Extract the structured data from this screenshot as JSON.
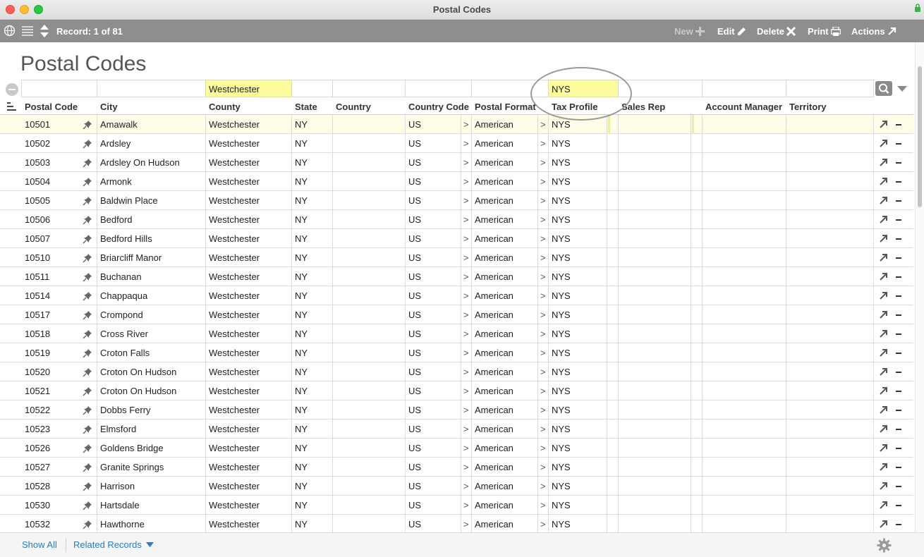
{
  "window": {
    "title": "Postal Codes"
  },
  "toolbar": {
    "record_label": "Record: 1 of 81",
    "new_label": "New",
    "edit_label": "Edit",
    "delete_label": "Delete",
    "print_label": "Print",
    "actions_label": "Actions"
  },
  "layout": {
    "title": "Postal Codes"
  },
  "find": {
    "county": "Westchester",
    "tax_profile": "NYS"
  },
  "columns": [
    "Postal Code",
    "City",
    "County",
    "State",
    "Country",
    "Country Code",
    "Postal Format",
    "Tax Profile",
    "Sales Rep",
    "Account Manager",
    "Territory"
  ],
  "rows": [
    {
      "postal_code": "10501",
      "city": "Amawalk",
      "county": "Westchester",
      "state": "NY",
      "country": "",
      "country_code": "US",
      "postal_format": "American",
      "tax_profile": "NYS",
      "sales_rep": "",
      "account_manager": "",
      "territory": ""
    },
    {
      "postal_code": "10502",
      "city": "Ardsley",
      "county": "Westchester",
      "state": "NY",
      "country": "",
      "country_code": "US",
      "postal_format": "American",
      "tax_profile": "NYS",
      "sales_rep": "",
      "account_manager": "",
      "territory": ""
    },
    {
      "postal_code": "10503",
      "city": "Ardsley On Hudson",
      "county": "Westchester",
      "state": "NY",
      "country": "",
      "country_code": "US",
      "postal_format": "American",
      "tax_profile": "NYS",
      "sales_rep": "",
      "account_manager": "",
      "territory": ""
    },
    {
      "postal_code": "10504",
      "city": "Armonk",
      "county": "Westchester",
      "state": "NY",
      "country": "",
      "country_code": "US",
      "postal_format": "American",
      "tax_profile": "NYS",
      "sales_rep": "",
      "account_manager": "",
      "territory": ""
    },
    {
      "postal_code": "10505",
      "city": "Baldwin Place",
      "county": "Westchester",
      "state": "NY",
      "country": "",
      "country_code": "US",
      "postal_format": "American",
      "tax_profile": "NYS",
      "sales_rep": "",
      "account_manager": "",
      "territory": ""
    },
    {
      "postal_code": "10506",
      "city": "Bedford",
      "county": "Westchester",
      "state": "NY",
      "country": "",
      "country_code": "US",
      "postal_format": "American",
      "tax_profile": "NYS",
      "sales_rep": "",
      "account_manager": "",
      "territory": ""
    },
    {
      "postal_code": "10507",
      "city": "Bedford Hills",
      "county": "Westchester",
      "state": "NY",
      "country": "",
      "country_code": "US",
      "postal_format": "American",
      "tax_profile": "NYS",
      "sales_rep": "",
      "account_manager": "",
      "territory": ""
    },
    {
      "postal_code": "10510",
      "city": "Briarcliff Manor",
      "county": "Westchester",
      "state": "NY",
      "country": "",
      "country_code": "US",
      "postal_format": "American",
      "tax_profile": "NYS",
      "sales_rep": "",
      "account_manager": "",
      "territory": ""
    },
    {
      "postal_code": "10511",
      "city": "Buchanan",
      "county": "Westchester",
      "state": "NY",
      "country": "",
      "country_code": "US",
      "postal_format": "American",
      "tax_profile": "NYS",
      "sales_rep": "",
      "account_manager": "",
      "territory": ""
    },
    {
      "postal_code": "10514",
      "city": "Chappaqua",
      "county": "Westchester",
      "state": "NY",
      "country": "",
      "country_code": "US",
      "postal_format": "American",
      "tax_profile": "NYS",
      "sales_rep": "",
      "account_manager": "",
      "territory": ""
    },
    {
      "postal_code": "10517",
      "city": "Crompond",
      "county": "Westchester",
      "state": "NY",
      "country": "",
      "country_code": "US",
      "postal_format": "American",
      "tax_profile": "NYS",
      "sales_rep": "",
      "account_manager": "",
      "territory": ""
    },
    {
      "postal_code": "10518",
      "city": "Cross River",
      "county": "Westchester",
      "state": "NY",
      "country": "",
      "country_code": "US",
      "postal_format": "American",
      "tax_profile": "NYS",
      "sales_rep": "",
      "account_manager": "",
      "territory": ""
    },
    {
      "postal_code": "10519",
      "city": "Croton Falls",
      "county": "Westchester",
      "state": "NY",
      "country": "",
      "country_code": "US",
      "postal_format": "American",
      "tax_profile": "NYS",
      "sales_rep": "",
      "account_manager": "",
      "territory": ""
    },
    {
      "postal_code": "10520",
      "city": "Croton On Hudson",
      "county": "Westchester",
      "state": "NY",
      "country": "",
      "country_code": "US",
      "postal_format": "American",
      "tax_profile": "NYS",
      "sales_rep": "",
      "account_manager": "",
      "territory": ""
    },
    {
      "postal_code": "10521",
      "city": "Croton On Hudson",
      "county": "Westchester",
      "state": "NY",
      "country": "",
      "country_code": "US",
      "postal_format": "American",
      "tax_profile": "NYS",
      "sales_rep": "",
      "account_manager": "",
      "territory": ""
    },
    {
      "postal_code": "10522",
      "city": "Dobbs Ferry",
      "county": "Westchester",
      "state": "NY",
      "country": "",
      "country_code": "US",
      "postal_format": "American",
      "tax_profile": "NYS",
      "sales_rep": "",
      "account_manager": "",
      "territory": ""
    },
    {
      "postal_code": "10523",
      "city": "Elmsford",
      "county": "Westchester",
      "state": "NY",
      "country": "",
      "country_code": "US",
      "postal_format": "American",
      "tax_profile": "NYS",
      "sales_rep": "",
      "account_manager": "",
      "territory": ""
    },
    {
      "postal_code": "10526",
      "city": "Goldens Bridge",
      "county": "Westchester",
      "state": "NY",
      "country": "",
      "country_code": "US",
      "postal_format": "American",
      "tax_profile": "NYS",
      "sales_rep": "",
      "account_manager": "",
      "territory": ""
    },
    {
      "postal_code": "10527",
      "city": "Granite Springs",
      "county": "Westchester",
      "state": "NY",
      "country": "",
      "country_code": "US",
      "postal_format": "American",
      "tax_profile": "NYS",
      "sales_rep": "",
      "account_manager": "",
      "territory": ""
    },
    {
      "postal_code": "10528",
      "city": "Harrison",
      "county": "Westchester",
      "state": "NY",
      "country": "",
      "country_code": "US",
      "postal_format": "American",
      "tax_profile": "NYS",
      "sales_rep": "",
      "account_manager": "",
      "territory": ""
    },
    {
      "postal_code": "10530",
      "city": "Hartsdale",
      "county": "Westchester",
      "state": "NY",
      "country": "",
      "country_code": "US",
      "postal_format": "American",
      "tax_profile": "NYS",
      "sales_rep": "",
      "account_manager": "",
      "territory": ""
    },
    {
      "postal_code": "10532",
      "city": "Hawthorne",
      "county": "Westchester",
      "state": "NY",
      "country": "",
      "country_code": "US",
      "postal_format": "American",
      "tax_profile": "NYS",
      "sales_rep": "",
      "account_manager": "",
      "territory": ""
    }
  ],
  "footer": {
    "show_all_label": "Show All",
    "related_label": "Related Records"
  },
  "colors": {
    "toolbar_bg": "#8e8e8e",
    "find_highlight": "#fcfc9c",
    "active_row": "#fffde8",
    "link": "#2a7bc0"
  },
  "icons": [
    "globe-icon",
    "list-icon",
    "up-down-arrows-icon",
    "plus-icon",
    "pencil-icon",
    "x-icon",
    "printer-icon",
    "arrow-out-icon",
    "search-icon",
    "chevron-down-icon",
    "sort-icon",
    "pin-icon",
    "minus-icon",
    "gear-icon",
    "lock-icon"
  ]
}
